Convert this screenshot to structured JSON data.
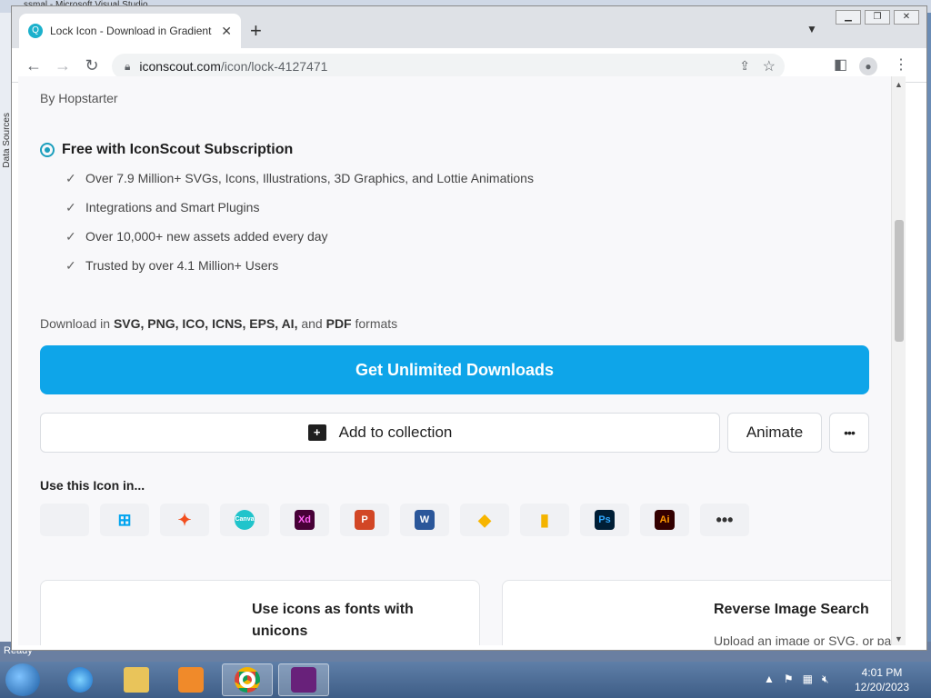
{
  "background": {
    "vs_title": "ssmal - Microsoft Visual Studio",
    "vs_side_label": "Data Sources",
    "status": "Ready"
  },
  "browser": {
    "tab_title": "Lock Icon - Download in Gradient",
    "url_host": "iconscout.com",
    "url_path": "/icon/lock-4127471"
  },
  "page": {
    "by_line": "By Hopstarter",
    "plan_title": "Free with IconScout Subscription",
    "features": [
      "Over 7.9 Million+ SVGs, Icons, Illustrations, 3D Graphics, and Lottie Animations",
      "Integrations and Smart Plugins",
      "Over 10,000+ new assets added every day",
      "Trusted by over 4.1 Million+ Users"
    ],
    "formats_prefix": "Download in ",
    "formats_list": "SVG, PNG, ICO, ICNS, EPS, AI,",
    "formats_and": " and ",
    "formats_pdf": "PDF",
    "formats_suffix": " formats",
    "cta_label": "Get Unlimited Downloads",
    "add_collection_label": "Add to collection",
    "animate_label": "Animate",
    "more_label": "•••",
    "use_in_title": "Use this Icon in...",
    "apps": [
      {
        "name": "apple-icon",
        "glyph": "",
        "color": "#000000",
        "bg": "transparent"
      },
      {
        "name": "windows-icon",
        "glyph": "⊞",
        "color": "#00a4ef",
        "bg": "transparent"
      },
      {
        "name": "figma-icon",
        "glyph": "✦",
        "color": "#f24e1e",
        "bg": "transparent"
      },
      {
        "name": "canva-icon",
        "glyph": "Canva",
        "color": "#ffffff",
        "bg": "#20c4cb"
      },
      {
        "name": "xd-icon",
        "glyph": "Xd",
        "color": "#ff61f6",
        "bg": "#470137"
      },
      {
        "name": "powerpoint-icon",
        "glyph": "P",
        "color": "#ffffff",
        "bg": "#d24726"
      },
      {
        "name": "word-icon",
        "glyph": "W",
        "color": "#ffffff",
        "bg": "#2b579a"
      },
      {
        "name": "sketch-icon",
        "glyph": "◆",
        "color": "#f7b500",
        "bg": "transparent"
      },
      {
        "name": "google-slides-icon",
        "glyph": "▮",
        "color": "#f4b400",
        "bg": "transparent"
      },
      {
        "name": "photoshop-icon",
        "glyph": "Ps",
        "color": "#31a8ff",
        "bg": "#001e36"
      },
      {
        "name": "illustrator-icon",
        "glyph": "Ai",
        "color": "#ff9a00",
        "bg": "#330000"
      },
      {
        "name": "more-apps-icon",
        "glyph": "•••",
        "color": "#333333",
        "bg": "transparent"
      }
    ],
    "card1_title": "Use icons as fonts with unicons",
    "card2_title": "Reverse Image Search",
    "card2_sub": "Upload an image or SVG, or pa"
  },
  "taskbar": {
    "time": "4:01 PM",
    "date": "12/20/2023"
  },
  "colors": {
    "accent": "#0ea5e9",
    "radio": "#1c9fbd"
  }
}
